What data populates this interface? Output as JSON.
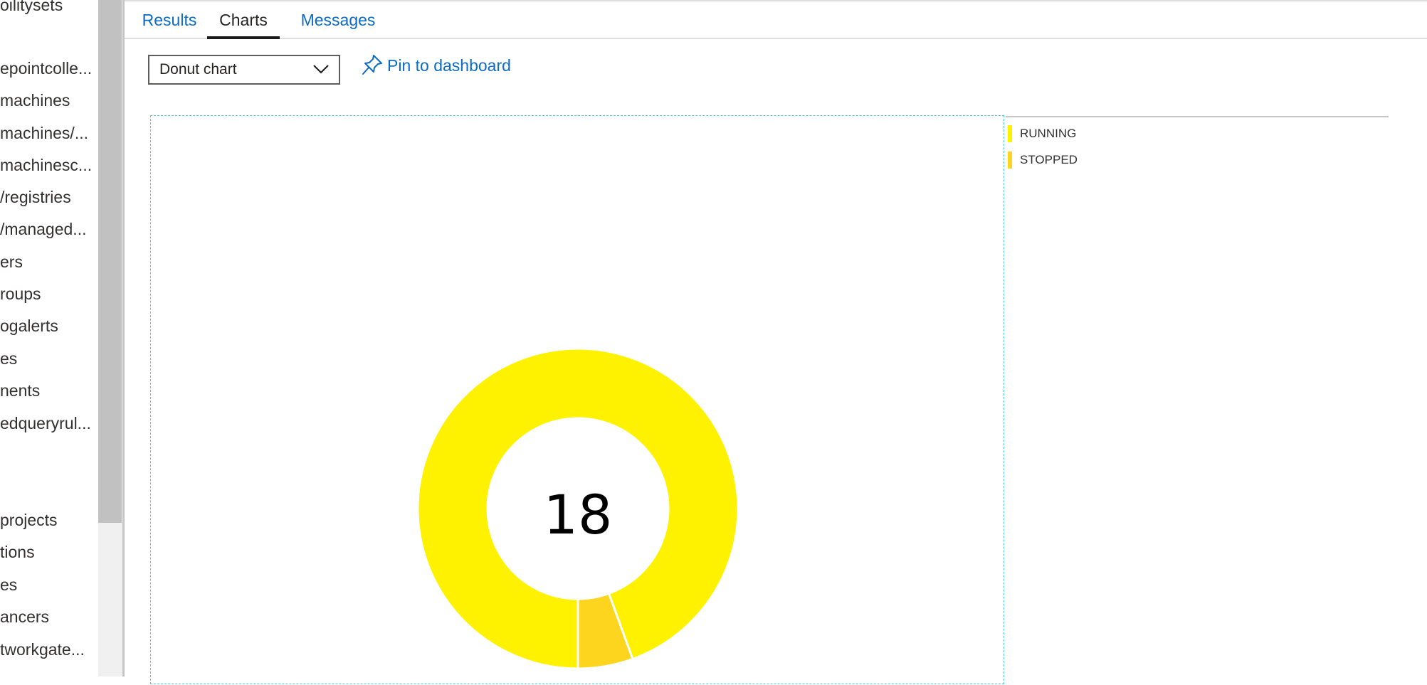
{
  "sidebar": {
    "items": [
      "oilitysets",
      "epointcolle...",
      "machines",
      "machines/...",
      "machinesc...",
      "/registries",
      "/managed...",
      "ers",
      "roups",
      "ogalerts",
      "es",
      "nents",
      "edqueryrul...",
      "projects",
      "tions",
      "es",
      "ancers",
      "tworkgate...",
      "..."
    ]
  },
  "tabs": [
    {
      "label": "Results",
      "active": false
    },
    {
      "label": "Charts",
      "active": true
    },
    {
      "label": "Messages",
      "active": false
    }
  ],
  "toolbar": {
    "chart_type_value": "Donut chart",
    "pin_label": "Pin to dashboard",
    "accent_color": "#0b6bc7"
  },
  "chart_data": {
    "type": "pie",
    "style": "donut",
    "center_label": "18",
    "series": [
      {
        "name": "RUNNING",
        "value": 17,
        "color": "#fff200"
      },
      {
        "name": "STOPPED",
        "value": 1,
        "color": "#fdd51e"
      }
    ],
    "legend_position": "right"
  }
}
